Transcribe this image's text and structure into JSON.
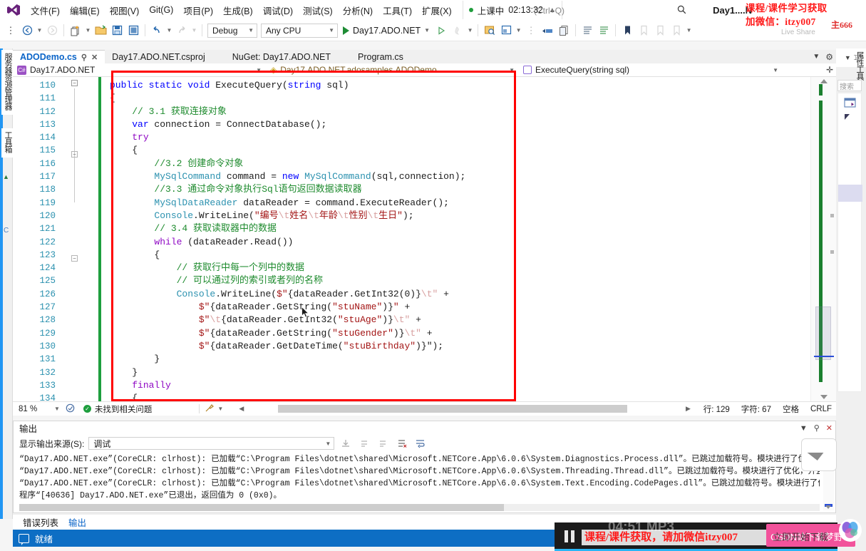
{
  "window": {
    "title": "Day1....N",
    "session_status": "上课中",
    "session_time": "02:13:32",
    "quick_search_placeholder": "(Ctrl+Q)",
    "live_share_label": "Live Share"
  },
  "watermark": {
    "top_line1": "课程/课件学习获取",
    "top_line2": "加微信：itzy007",
    "top_tail": "主666",
    "video_text": "课程/课件获取，请加微信itzy007",
    "video_ghost": "04:51 MP3",
    "pink_text": "CSDN站下载梦野",
    "pink_text2": "立即开始下载"
  },
  "menu": {
    "items": [
      "文件(F)",
      "编辑(E)",
      "视图(V)",
      "Git(G)",
      "项目(P)",
      "生成(B)",
      "调试(D)",
      "测试(S)",
      "分析(N)",
      "工具(T)",
      "扩展(X)"
    ]
  },
  "toolbar": {
    "config": "Debug",
    "platform": "Any CPU",
    "run_target": "Day17.ADO.NET"
  },
  "tabs": [
    {
      "label": "ADODemo.cs",
      "active": true
    },
    {
      "label": "Day17.ADO.NET.csproj",
      "active": false
    },
    {
      "label": "NuGet: Day17.ADO.NET",
      "active": false
    },
    {
      "label": "Program.cs",
      "active": false
    }
  ],
  "navbar": {
    "project": "Day17.ADO.NET",
    "type": "Day17.ADO.NET.adosamples.ADODemo",
    "member": "ExecuteQuery(string sql)"
  },
  "editor": {
    "first_line": 110,
    "lines": [
      {
        "n": 110,
        "tokens": [
          {
            "t": "public ",
            "c": "kw"
          },
          {
            "t": "static ",
            "c": "kw"
          },
          {
            "t": "void ",
            "c": "kw"
          },
          {
            "t": "ExecuteQuery",
            "c": "plain"
          },
          {
            "t": "(",
            "c": "op"
          },
          {
            "t": "string",
            "c": "kw"
          },
          {
            "t": " sql)",
            "c": "plain"
          }
        ]
      },
      {
        "n": 111,
        "tokens": [
          {
            "t": "{",
            "c": "plain"
          }
        ]
      },
      {
        "n": 112,
        "tokens": [
          {
            "t": "    // 3.1 获取连接对象",
            "c": "cm"
          }
        ]
      },
      {
        "n": 113,
        "tokens": [
          {
            "t": "    ",
            "c": "plain"
          },
          {
            "t": "var",
            "c": "kw"
          },
          {
            "t": " connection = ",
            "c": "plain"
          },
          {
            "t": "ConnectDatabase",
            "c": "plain"
          },
          {
            "t": "();",
            "c": "plain"
          }
        ]
      },
      {
        "n": 114,
        "tokens": [
          {
            "t": "    ",
            "c": "plain"
          },
          {
            "t": "try",
            "c": "kw2"
          }
        ]
      },
      {
        "n": 115,
        "tokens": [
          {
            "t": "    {",
            "c": "plain"
          }
        ]
      },
      {
        "n": 116,
        "tokens": [
          {
            "t": "        //3.2 创建命令对象",
            "c": "cm"
          }
        ]
      },
      {
        "n": 117,
        "tokens": [
          {
            "t": "        ",
            "c": "plain"
          },
          {
            "t": "MySqlCommand",
            "c": "type"
          },
          {
            "t": " command = ",
            "c": "plain"
          },
          {
            "t": "new ",
            "c": "kw"
          },
          {
            "t": "MySqlCommand",
            "c": "type"
          },
          {
            "t": "(sql,connection);",
            "c": "plain"
          }
        ]
      },
      {
        "n": 118,
        "tokens": [
          {
            "t": "        //3.3 通过命令对象执行Sql语句返回数据读取器",
            "c": "cm"
          }
        ]
      },
      {
        "n": 119,
        "tokens": [
          {
            "t": "        ",
            "c": "plain"
          },
          {
            "t": "MySqlDataReader",
            "c": "type"
          },
          {
            "t": " dataReader = command.",
            "c": "plain"
          },
          {
            "t": "ExecuteReader",
            "c": "plain"
          },
          {
            "t": "();",
            "c": "plain"
          }
        ]
      },
      {
        "n": 120,
        "tokens": [
          {
            "t": "        ",
            "c": "plain"
          },
          {
            "t": "Console",
            "c": "type"
          },
          {
            "t": ".WriteLine(",
            "c": "plain"
          },
          {
            "t": "\"编号",
            "c": "str"
          },
          {
            "t": "\\t",
            "c": "esc"
          },
          {
            "t": "姓名",
            "c": "str"
          },
          {
            "t": "\\t",
            "c": "esc"
          },
          {
            "t": "年龄",
            "c": "str"
          },
          {
            "t": "\\t",
            "c": "esc"
          },
          {
            "t": "性别",
            "c": "str"
          },
          {
            "t": "\\t",
            "c": "esc"
          },
          {
            "t": "生日\"",
            "c": "str"
          },
          {
            "t": ");",
            "c": "plain"
          }
        ]
      },
      {
        "n": 121,
        "tokens": [
          {
            "t": "        // 3.4 获取读取器中的数据",
            "c": "cm"
          }
        ]
      },
      {
        "n": 122,
        "tokens": [
          {
            "t": "        ",
            "c": "plain"
          },
          {
            "t": "while",
            "c": "kw2"
          },
          {
            "t": " (dataReader.",
            "c": "plain"
          },
          {
            "t": "Read",
            "c": "plain"
          },
          {
            "t": "())",
            "c": "plain"
          }
        ]
      },
      {
        "n": 123,
        "tokens": [
          {
            "t": "        {",
            "c": "plain"
          }
        ]
      },
      {
        "n": 124,
        "tokens": [
          {
            "t": "            // 获取行中每一个列中的数据",
            "c": "cm"
          }
        ]
      },
      {
        "n": 125,
        "tokens": [
          {
            "t": "            // 可以通过列的索引或者列的名称",
            "c": "cm"
          }
        ]
      },
      {
        "n": 126,
        "tokens": [
          {
            "t": "            ",
            "c": "plain"
          },
          {
            "t": "Console",
            "c": "type"
          },
          {
            "t": ".WriteLine(",
            "c": "plain"
          },
          {
            "t": "$\"",
            "c": "str"
          },
          {
            "t": "{dataReader.GetInt32(0)}",
            "c": "plain"
          },
          {
            "t": "\\t\"",
            "c": "esc"
          },
          {
            "t": " +",
            "c": "plain"
          }
        ]
      },
      {
        "n": 127,
        "tokens": [
          {
            "t": "                ",
            "c": "plain"
          },
          {
            "t": "$\"",
            "c": "str"
          },
          {
            "t": "{dataReader.GetString(",
            "c": "plain"
          },
          {
            "t": "\"stuName\"",
            "c": "str"
          },
          {
            "t": ")}",
            "c": "plain"
          },
          {
            "t": "\"",
            "c": "str"
          },
          {
            "t": " +",
            "c": "plain"
          }
        ]
      },
      {
        "n": 128,
        "tokens": [
          {
            "t": "                ",
            "c": "plain"
          },
          {
            "t": "$\"",
            "c": "str"
          },
          {
            "t": "\\t",
            "c": "esc"
          },
          {
            "t": "{dataReader.GetInt32(",
            "c": "plain"
          },
          {
            "t": "\"stuAge\"",
            "c": "str"
          },
          {
            "t": ")}",
            "c": "plain"
          },
          {
            "t": "\\t\"",
            "c": "esc"
          },
          {
            "t": " +",
            "c": "plain"
          }
        ]
      },
      {
        "n": 129,
        "tokens": [
          {
            "t": "                ",
            "c": "plain"
          },
          {
            "t": "$\"",
            "c": "str"
          },
          {
            "t": "{dataReader.GetString(",
            "c": "plain"
          },
          {
            "t": "\"stuGender\"",
            "c": "str"
          },
          {
            "t": ")}",
            "c": "plain"
          },
          {
            "t": "\\t\"",
            "c": "esc"
          },
          {
            "t": " +",
            "c": "plain"
          }
        ]
      },
      {
        "n": 130,
        "tokens": [
          {
            "t": "                ",
            "c": "plain"
          },
          {
            "t": "$\"",
            "c": "str"
          },
          {
            "t": "{dataReader.GetDateTime(",
            "c": "plain"
          },
          {
            "t": "\"stuBirthday\"",
            "c": "str"
          },
          {
            "t": ")}\"",
            "c": "plain"
          },
          {
            "t": ");",
            "c": "plain"
          }
        ]
      },
      {
        "n": 131,
        "tokens": [
          {
            "t": "        }",
            "c": "plain"
          }
        ]
      },
      {
        "n": 132,
        "tokens": [
          {
            "t": "    }",
            "c": "plain"
          }
        ]
      },
      {
        "n": 133,
        "tokens": [
          {
            "t": "    ",
            "c": "plain"
          },
          {
            "t": "finally",
            "c": "kw2"
          }
        ]
      },
      {
        "n": 134,
        "tokens": [
          {
            "t": "    {",
            "c": "plain"
          }
        ]
      }
    ]
  },
  "editor_status": {
    "zoom": "81 %",
    "problems": "未找到相关问题",
    "line_label": "行: 129",
    "char_label": "字符: 67",
    "spaces": "空格",
    "eol": "CRLF"
  },
  "output": {
    "title": "输出",
    "source_label": "显示输出来源(S):",
    "source_value": "调试",
    "lines": [
      "“Day17.ADO.NET.exe”(CoreCLR: clrhost): 已加载“C:\\Program Files\\dotnet\\shared\\Microsoft.NETCore.App\\6.0.6\\System.Diagnostics.Process.dll”。已跳过加载符号。模块进行了优化，并且调试",
      "“Day17.ADO.NET.exe”(CoreCLR: clrhost): 已加载“C:\\Program Files\\dotnet\\shared\\Microsoft.NETCore.App\\6.0.6\\System.Threading.Thread.dll”。已跳过加载符号。模块进行了优化，并且调试",
      "“Day17.ADO.NET.exe”(CoreCLR: clrhost): 已加载“C:\\Program Files\\dotnet\\shared\\Microsoft.NETCore.App\\6.0.6\\System.Text.Encoding.CodePages.dll”。已跳过加载符号。模块进行了优化，并且",
      "程序“[40636] Day17.ADO.NET.exe”已退出，返回值为 0 (0x0)。"
    ]
  },
  "bottom_tabs": [
    {
      "label": "错误列表",
      "active": true
    },
    {
      "label": "输出",
      "active": false
    }
  ],
  "statusbar": {
    "text": "就绪"
  },
  "left_dock": {
    "items": [
      "服务器资源管理器",
      "工具箱"
    ]
  },
  "right_dock": {
    "search_placeholder": "搜索",
    "label": "属性工具"
  },
  "colors": {
    "accent": "#0d6ec4",
    "annotation_red": "#ff0000",
    "keyword_blue": "#0000ff",
    "type_teal": "#2b91af",
    "comment_green": "#1e8b2e",
    "string_red": "#a31515",
    "changebar_green": "#1e9e3e",
    "pink_badge": "#f2529b"
  }
}
